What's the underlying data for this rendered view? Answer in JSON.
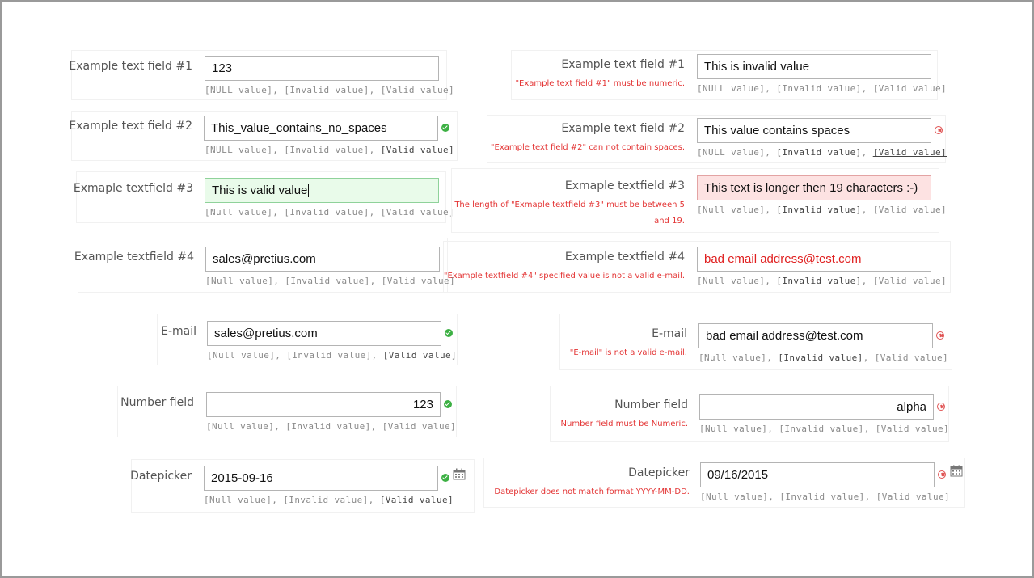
{
  "link_labels": {
    "null_upper": "[NULL value]",
    "invalid": "[Invalid value]",
    "valid": "[Valid value]",
    "null_lower": "[Null value]",
    "separator": ", "
  },
  "colors": {
    "valid_icon": "#3cb043",
    "error": "#e33333",
    "valid_bg": "#e9fbea",
    "invalid_bg": "#fde2e2"
  },
  "left": {
    "field1": {
      "label": "Example text field #1",
      "value": "123"
    },
    "field2": {
      "label": "Example text field #2",
      "value": "This_value_contains_no_spaces"
    },
    "field3": {
      "label": "Exmaple textfield #3",
      "value": "This is valid value"
    },
    "field4": {
      "label": "Example textfield #4",
      "value": "sales@pretius.com"
    },
    "email": {
      "label": "E-mail",
      "value": "sales@pretius.com"
    },
    "number": {
      "label": "Number field",
      "value": "123"
    },
    "date": {
      "label": "Datepicker",
      "value": "2015-09-16"
    }
  },
  "right": {
    "field1": {
      "label": "Example text field #1",
      "value": "This is invalid value",
      "error": "\"Example text field #1\" must be numeric."
    },
    "field2": {
      "label": "Example text field #2",
      "value": "This value contains spaces",
      "error": "\"Example text field #2\" can not contain spaces."
    },
    "field3": {
      "label": "Exmaple textfield #3",
      "value": "This text is longer then 19 characters :-)",
      "error_line1": "The length of \"Exmaple textfield #3\" must be between 5",
      "error_line2": "and 19."
    },
    "field4": {
      "label": "Example textfield #4",
      "value": "bad email address@test.com",
      "error": "\"Example textfield #4\" specified value is not a valid e-mail."
    },
    "email": {
      "label": "E-mail",
      "value": "bad email address@test.com",
      "error": "\"E-mail\" is not a valid e-mail."
    },
    "number": {
      "label": "Number field",
      "value": "alpha",
      "error": "Number field must be Numeric."
    },
    "date": {
      "label": "Datepicker",
      "value": "09/16/2015",
      "error": "Datepicker does not match format YYYY-MM-DD."
    }
  }
}
